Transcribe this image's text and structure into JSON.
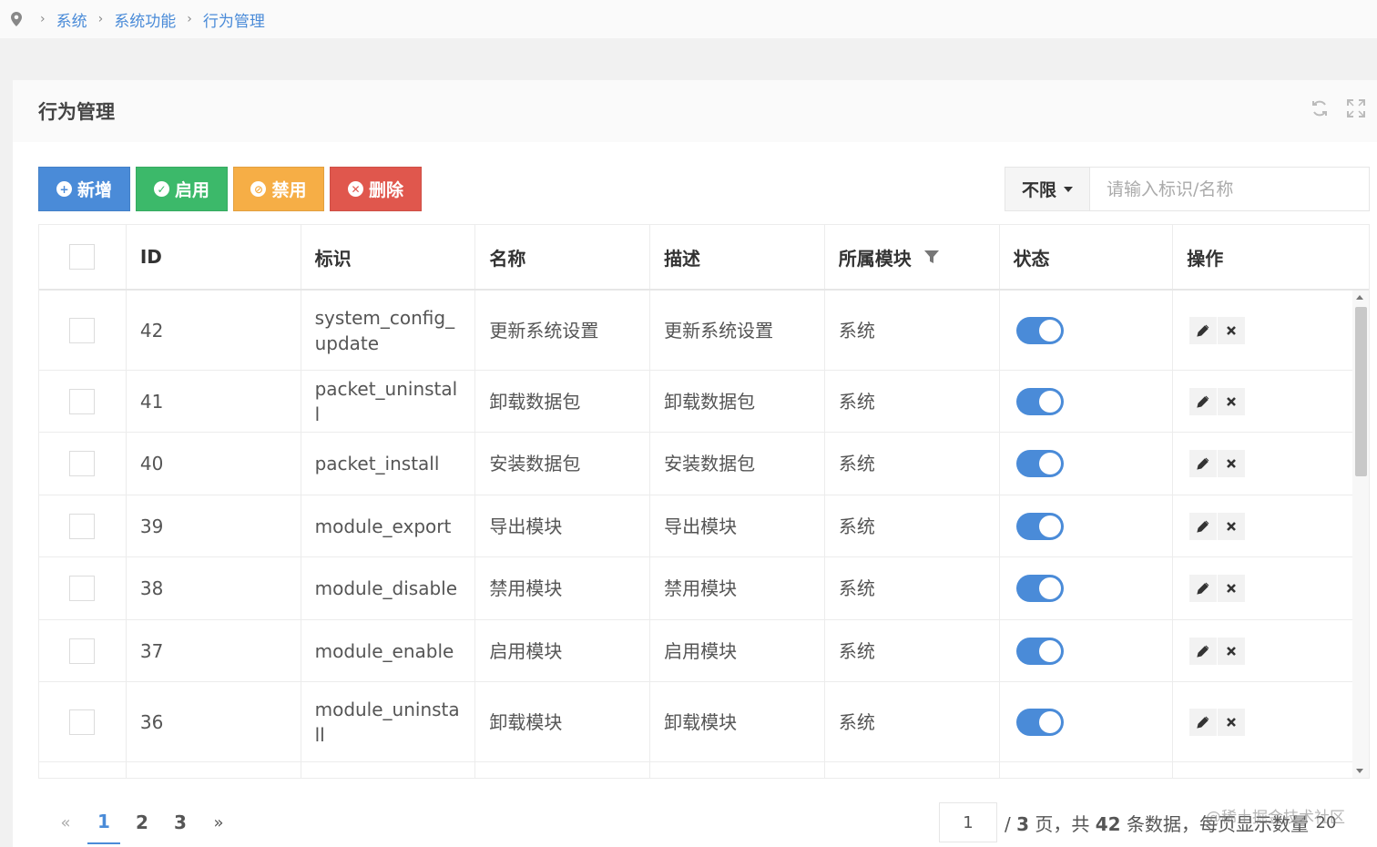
{
  "breadcrumb": {
    "icon": "location-pin-icon",
    "items": [
      "系统",
      "系统功能",
      "行为管理"
    ]
  },
  "panel": {
    "title": "行为管理",
    "tools": [
      "refresh-icon",
      "fullscreen-icon"
    ]
  },
  "toolbar": {
    "add_label": "新增",
    "enable_label": "启用",
    "disable_label": "禁用",
    "delete_label": "删除"
  },
  "search": {
    "filter_value": "不限",
    "placeholder": "请输入标识/名称"
  },
  "table": {
    "headers": {
      "id": "ID",
      "key": "标识",
      "name": "名称",
      "desc": "描述",
      "module": "所属模块",
      "status": "状态",
      "actions": "操作"
    },
    "rows": [
      {
        "id": "42",
        "key": "system_config_update",
        "name": "更新系统设置",
        "desc": "更新系统设置",
        "module": "系统",
        "enabled": true
      },
      {
        "id": "41",
        "key": "packet_uninstall",
        "name": "卸载数据包",
        "desc": "卸载数据包",
        "module": "系统",
        "enabled": true
      },
      {
        "id": "40",
        "key": "packet_install",
        "name": "安装数据包",
        "desc": "安装数据包",
        "module": "系统",
        "enabled": true
      },
      {
        "id": "39",
        "key": "module_export",
        "name": "导出模块",
        "desc": "导出模块",
        "module": "系统",
        "enabled": true
      },
      {
        "id": "38",
        "key": "module_disable",
        "name": "禁用模块",
        "desc": "禁用模块",
        "module": "系统",
        "enabled": true
      },
      {
        "id": "37",
        "key": "module_enable",
        "name": "启用模块",
        "desc": "启用模块",
        "module": "系统",
        "enabled": true
      },
      {
        "id": "36",
        "key": "module_uninstall",
        "name": "卸载模块",
        "desc": "卸载模块",
        "module": "系统",
        "enabled": true
      }
    ]
  },
  "pagination": {
    "prev": "«",
    "pages": [
      "1",
      "2",
      "3"
    ],
    "current": "1",
    "next": "»",
    "page_input": "1",
    "info_prefix": "/",
    "total_pages": "3",
    "info_mid": "页，共",
    "total_items": "42",
    "info_suffix": "条数据，每页显示数量",
    "per_page": "20"
  },
  "watermark": "@稀土掘金技术社区",
  "colors": {
    "primary": "#4a8bd8",
    "success": "#3cb96a",
    "warning": "#f6ae46",
    "danger": "#e0574d"
  }
}
